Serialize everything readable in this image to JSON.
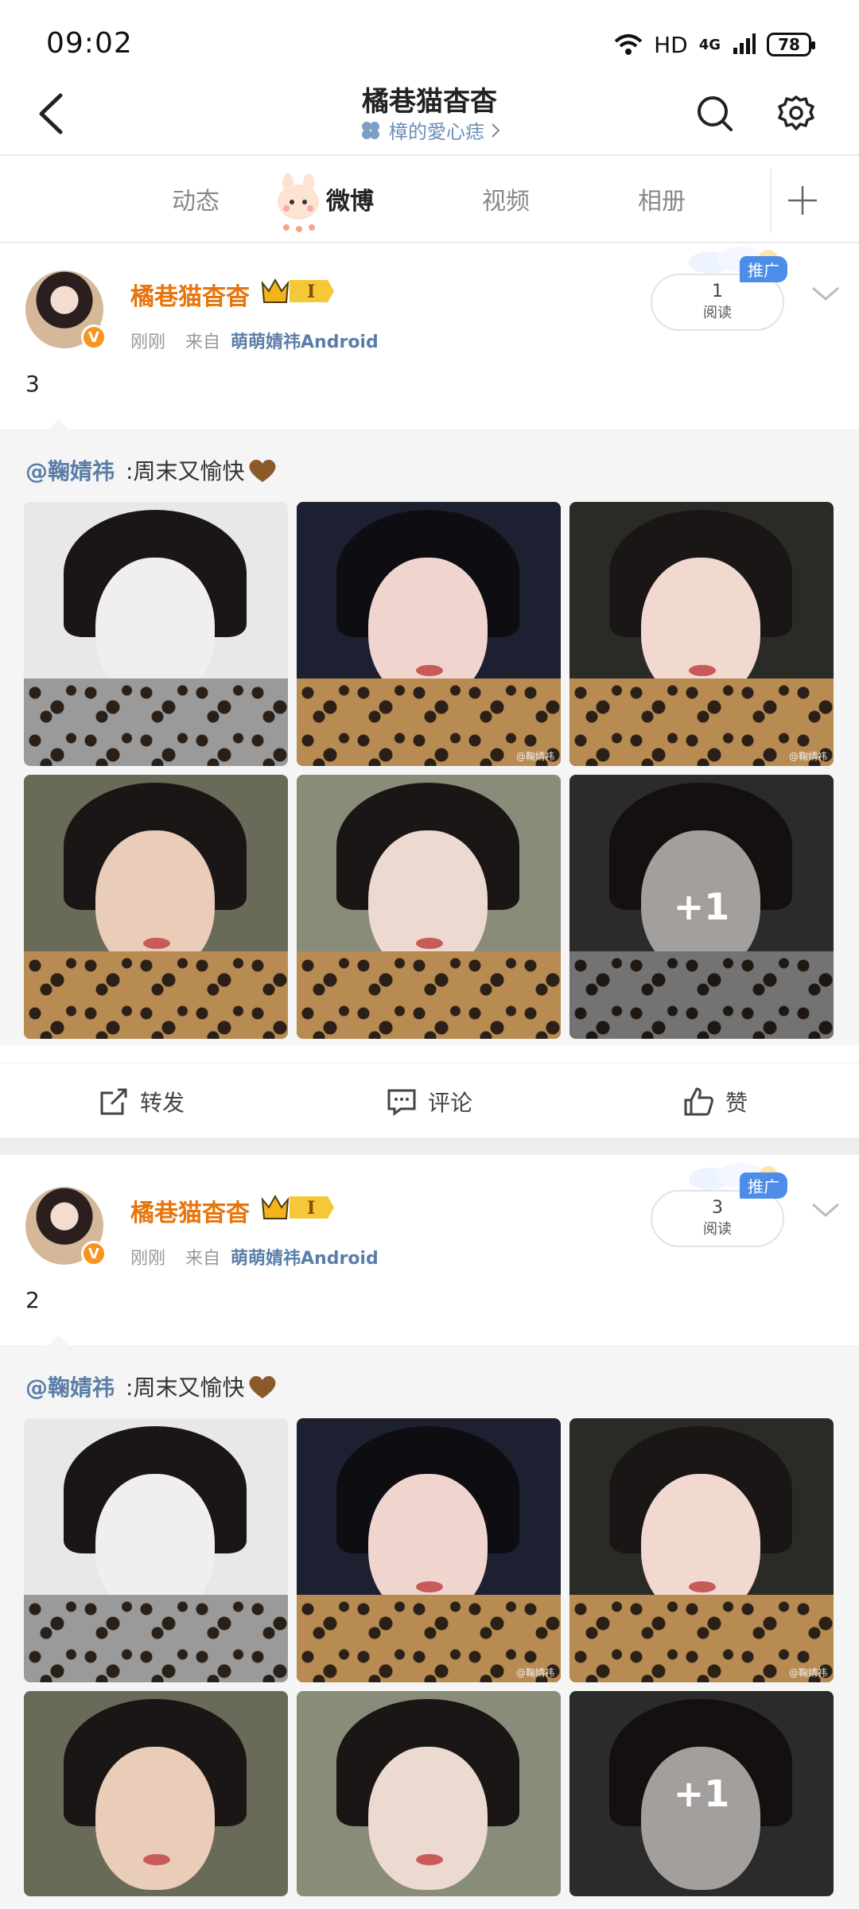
{
  "status_bar": {
    "time": "09:02",
    "network": "HD",
    "signal_label": "4G",
    "battery": "78"
  },
  "header": {
    "title": "橘巷猫杳杳",
    "subtitle": "樟的愛心痣",
    "subtitle_icon": "clover-icon"
  },
  "tabs": [
    {
      "label": "动态",
      "active": false
    },
    {
      "label": "微博",
      "active": true
    },
    {
      "label": "视频",
      "active": false
    },
    {
      "label": "相册",
      "active": false
    }
  ],
  "posts": [
    {
      "username": "橘巷猫杳杳",
      "vip_level": "I",
      "time": "刚刚",
      "from_label": "来自",
      "source": "萌萌婧祎Android",
      "read_count": "1",
      "read_label": "阅读",
      "promo_label": "推广",
      "text": "3",
      "repost_mention": "@鞠婧祎",
      "repost_text": ":周末又愉快",
      "photos_more": "+1",
      "watermark": "@鞠婧祎",
      "actions": {
        "forward": "转发",
        "comment": "评论",
        "like": "赞"
      }
    },
    {
      "username": "橘巷猫杳杳",
      "vip_level": "I",
      "time": "刚刚",
      "from_label": "来自",
      "source": "萌萌婧祎Android",
      "read_count": "3",
      "read_label": "阅读",
      "promo_label": "推广",
      "text": "2",
      "repost_mention": "@鞠婧祎",
      "repost_text": ":周末又愉快",
      "photos_more": "+1",
      "watermark": "@鞠婧祎"
    }
  ],
  "colors": {
    "username": "#e8740c",
    "link": "#5b7ea8",
    "promo": "#4d8de8"
  }
}
